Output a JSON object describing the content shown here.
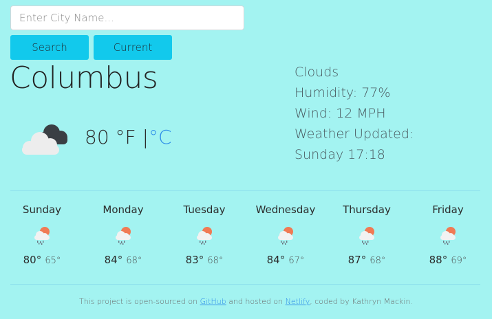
{
  "search": {
    "placeholder": "Enter City Name...",
    "value": "",
    "search_label": "Search",
    "current_label": "Current"
  },
  "current": {
    "city": "Columbus",
    "temp": "80",
    "unit_f": "°F",
    "separator": "|",
    "unit_c": "°C",
    "icon": "cloudy-icon",
    "description": "Clouds",
    "humidity": "Humidity: 77%",
    "wind": "Wind: 12 MPH",
    "updated_label": "Weather Updated:",
    "updated_time": "Sunday 17:18"
  },
  "forecast": [
    {
      "day": "Sunday",
      "hi": "80°",
      "lo": "65°",
      "icon": "sun-rain-cloud-icon"
    },
    {
      "day": "Monday",
      "hi": "84°",
      "lo": "68°",
      "icon": "sun-rain-cloud-icon"
    },
    {
      "day": "Tuesday",
      "hi": "83°",
      "lo": "68°",
      "icon": "sun-rain-cloud-icon"
    },
    {
      "day": "Wednesday",
      "hi": "84°",
      "lo": "67°",
      "icon": "sun-rain-cloud-icon"
    },
    {
      "day": "Thursday",
      "hi": "87°",
      "lo": "68°",
      "icon": "sun-rain-cloud-icon"
    },
    {
      "day": "Friday",
      "hi": "88°",
      "lo": "69°",
      "icon": "sun-rain-cloud-icon"
    }
  ],
  "footer": {
    "prefix": "This project is open-sourced on ",
    "github_label": "GitHub",
    "middle": " and hosted on ",
    "netlify_label": "Netlify",
    "suffix": ", coded by Kathryn Mackin."
  },
  "colors": {
    "background": "#a3f3f1",
    "button": "#12c9ec",
    "accent": "#2f8fe8"
  }
}
